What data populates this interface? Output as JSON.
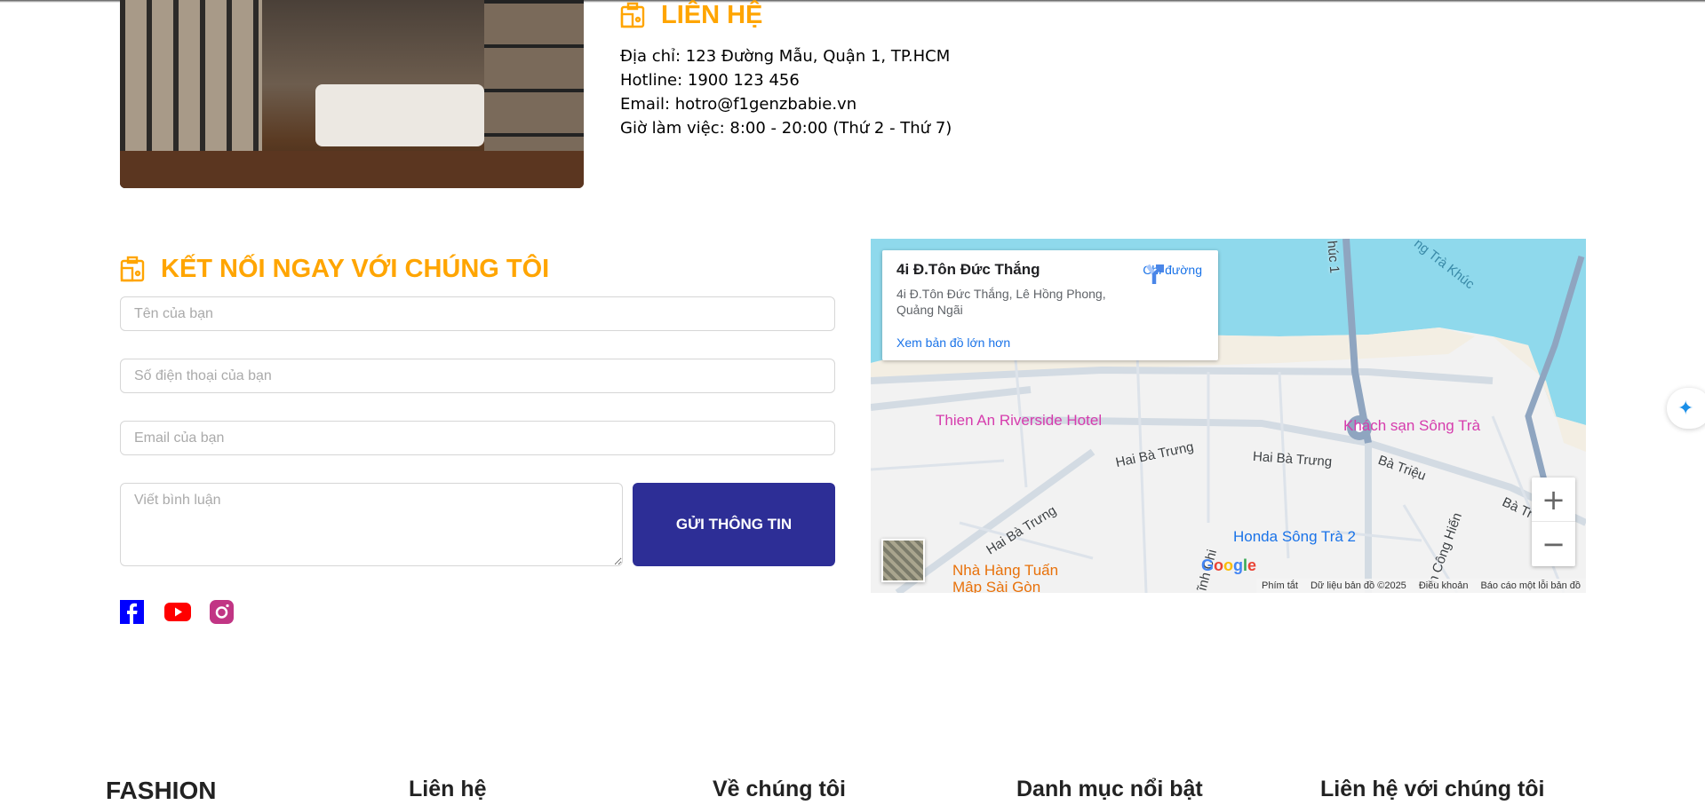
{
  "contact": {
    "heading": "LIÊN HỆ",
    "address": "Địa chỉ: 123 Đường Mẫu, Quận 1, TP.HCM",
    "hotline": "Hotline: 1900 123 456",
    "email": "Email: hotro@f1genzbabie.vn",
    "hours": "Giờ làm việc: 8:00 - 20:00 (Thứ 2 - Thứ 7)"
  },
  "form": {
    "heading": "KẾT NỐI NGAY VỚI CHÚNG TÔI",
    "name_placeholder": "Tên của bạn",
    "phone_placeholder": "Số điện thoại của bạn",
    "email_placeholder": "Email của bạn",
    "comment_placeholder": "Viết bình luận",
    "submit_label": "GỬI THÔNG TIN"
  },
  "social": [
    "facebook-icon",
    "youtube-icon",
    "instagram-icon"
  ],
  "map": {
    "place_title": "4i Đ.Tôn Đức Thắng",
    "place_address": "4i Đ.Tôn Đức Thắng, Lê Hồng Phong, Quảng Ngãi",
    "directions": "Chỉ đường",
    "larger_map": "Xem bản đồ lớn hơn",
    "pois": {
      "hotel1": "Thien An Riverside Hotel",
      "hotel2": "Khách sạn Sông Trà",
      "shop": "Honda Sông Trà 2",
      "restaurant": "Nhà Hàng Tuấn Mập Sài Gòn"
    },
    "streets": {
      "s1": "Hai Bà Trưng",
      "s2": "Hai Bà Trưng",
      "s3": "Hai Bà Trưng",
      "s4": "Bà Triệu",
      "s5": "Bà Tr",
      "s6": "ng Trà Khúc",
      "s7": "húc 1",
      "s8": "n Công Hiến",
      "s9": "ĩnh Chi"
    },
    "google": "Google",
    "attribution": {
      "shortcuts": "Phím tắt",
      "data": "Dữ liệu bản đồ ©2025",
      "terms": "Điều khoản",
      "report": "Báo cáo một lỗi bản đồ"
    },
    "zoom_in": "+",
    "zoom_out": "−",
    "colors": {
      "water": "#8fd9ec",
      "land": "#f2f2f2",
      "road": "#d3dbe3",
      "pin": "#ea4335"
    }
  },
  "footer": {
    "brand": "FASHION",
    "col1": "Liên hệ",
    "col2": "Về chúng tôi",
    "col3": "Danh mục nổi bật",
    "col4": "Liên hệ với chúng tôi"
  },
  "colors": {
    "accent": "#ffa500",
    "button": "#2d2e96"
  }
}
